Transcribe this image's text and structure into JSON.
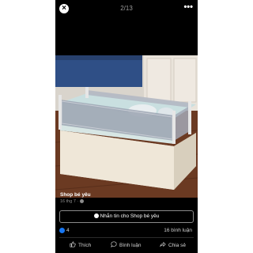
{
  "viewer": {
    "counter": "2/13",
    "close_glyph": "×",
    "more_glyph": "•••"
  },
  "photo": {
    "description_icon": "photo-of-bed-with-rail"
  },
  "caption": {
    "author": "Shop bé yêu",
    "date": "16 thg 7 · "
  },
  "message_button": {
    "label": "Nhắn tin cho Shop bé yêu"
  },
  "stats": {
    "likes": "4",
    "comments": "16 bình luận"
  },
  "actions": {
    "like": "Thích",
    "comment": "Bình luận",
    "share": "Chia sẻ"
  },
  "colors": {
    "background": "#000000",
    "like_badge": "#1877f2",
    "page_margin": "#ffffff"
  }
}
